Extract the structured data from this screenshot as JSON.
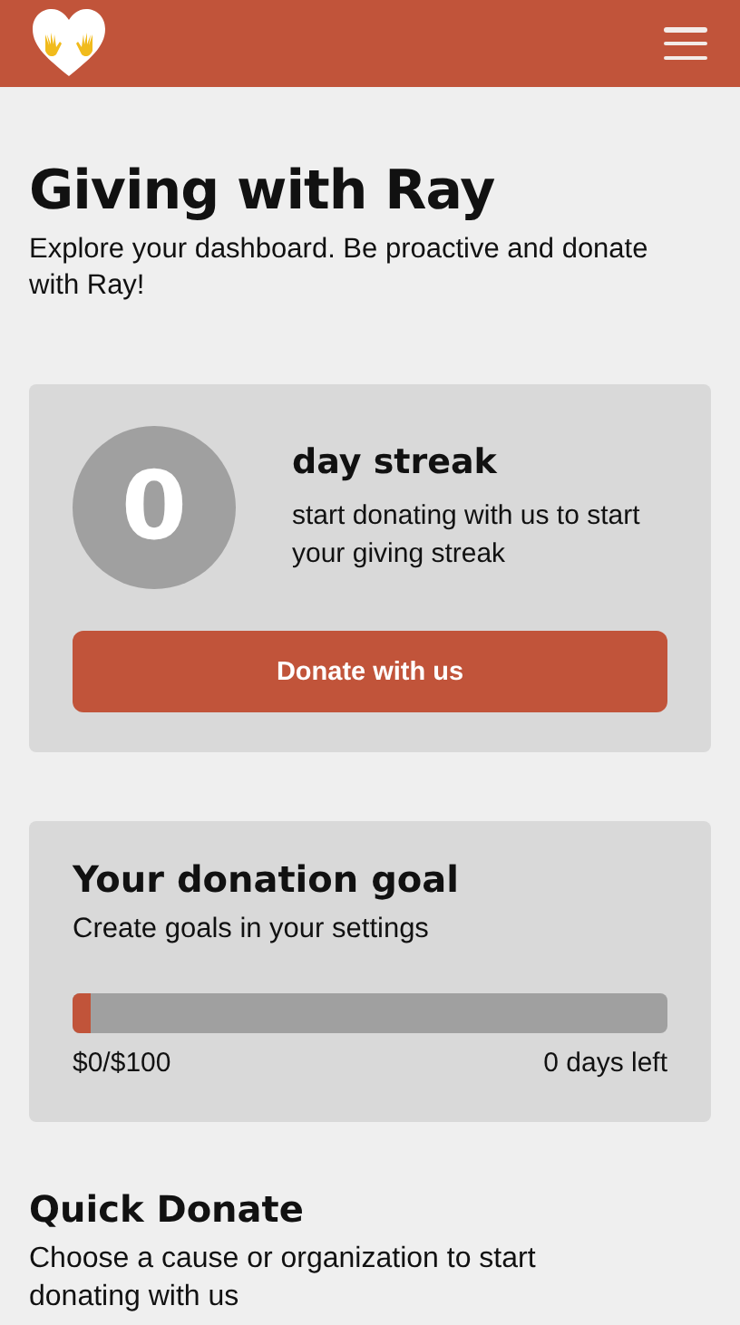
{
  "page": {
    "title": "Giving with Ray",
    "subtitle": "Explore your dashboard. Be proactive and donate with Ray!"
  },
  "streak": {
    "count": "0",
    "title": "day streak",
    "text": "start donating with us to start your giving streak",
    "button": "Donate with us"
  },
  "goal": {
    "title": "Your donation goal",
    "text": "Create goals in your settings",
    "level": 0.03,
    "amount": "$0/$100",
    "days_left": "0 days left"
  },
  "quick_donate": {
    "title": "Quick Donate",
    "text": "Choose a cause or organization to start donating with us"
  }
}
